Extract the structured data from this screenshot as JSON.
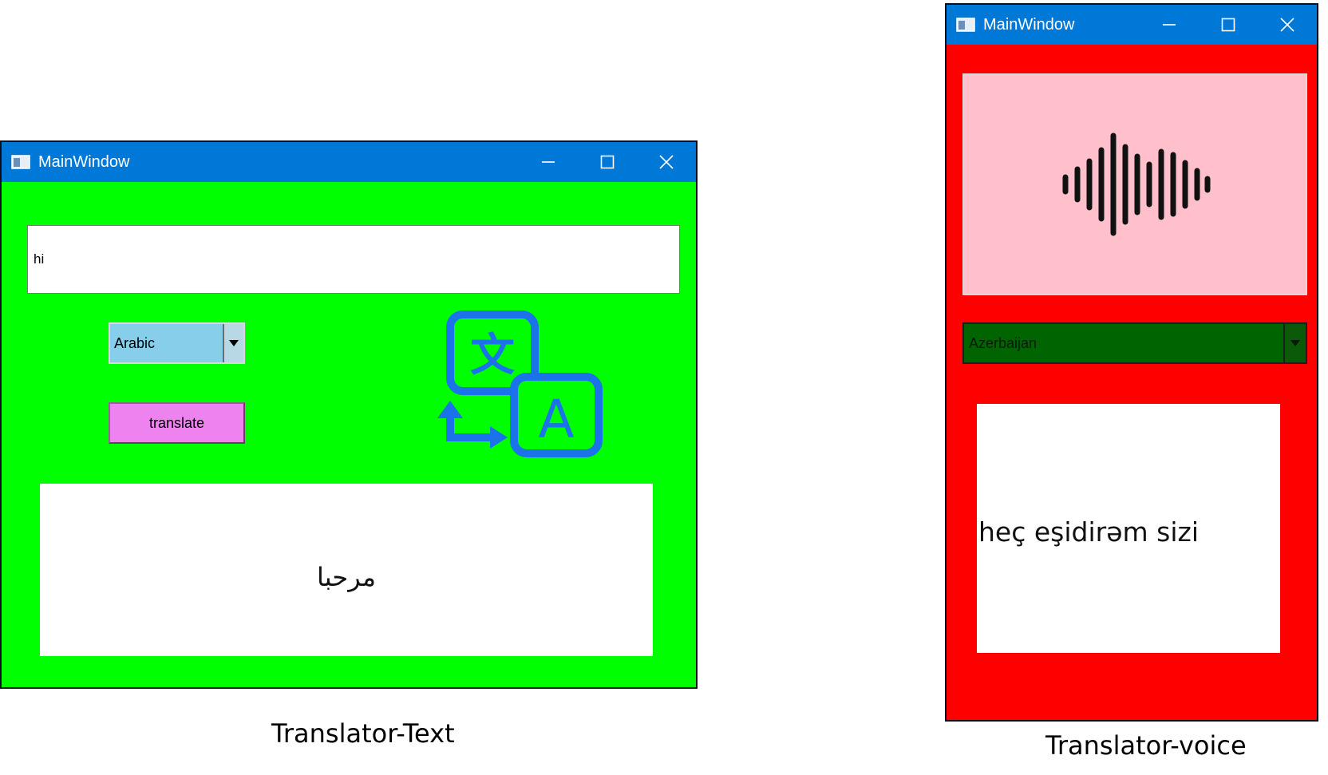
{
  "text_window": {
    "title": "MainWindow",
    "source_text": "hi",
    "language_combo": {
      "selected": "Arabic"
    },
    "translate_button_label": "translate",
    "output_text": "مرحبا",
    "logo_icon": "translate-icon",
    "colors": {
      "background": "#00ff00",
      "titlebar": "#0078d7",
      "combo": "#87ceeb",
      "button": "#ee82ee",
      "logo": "#1a73e8"
    }
  },
  "voice_window": {
    "title": "MainWindow",
    "voice_icon": "sound-wave-icon",
    "language_combo": {
      "selected": "Azerbaijan"
    },
    "output_text": "heç eşidirəm sizi",
    "colors": {
      "background": "#ff0000",
      "voice_panel": "#ffc0cb",
      "combo": "#006400"
    }
  },
  "captions": {
    "text_translator": "Translator-Text",
    "voice_translator": "Translator-voice"
  }
}
